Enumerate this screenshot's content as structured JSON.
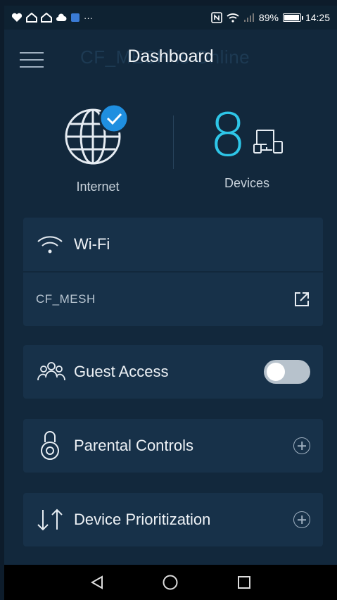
{
  "status_bar": {
    "left_icons": [
      "heart-icon",
      "home-icon",
      "home-icon",
      "cloud-icon",
      "app-icon"
    ],
    "more": "···",
    "battery_percent": "89%",
    "battery_level": 0.89,
    "time": "14:25"
  },
  "header": {
    "title": "Dashboard",
    "ghost_title": "CF_MESH is Online"
  },
  "summary": {
    "internet_label": "Internet",
    "internet_status": "connected",
    "devices_count": "8",
    "devices_label": "Devices"
  },
  "wifi_card": {
    "label": "Wi-Fi",
    "ssid": "CF_MESH"
  },
  "guest_card": {
    "label": "Guest Access",
    "enabled": false
  },
  "parental_card": {
    "label": "Parental Controls"
  },
  "priority_card": {
    "label": "Device Prioritization"
  },
  "colors": {
    "background": "#12283c",
    "card": "#173149",
    "accent": "#2ec6e8",
    "badge": "#1f8fe0"
  }
}
